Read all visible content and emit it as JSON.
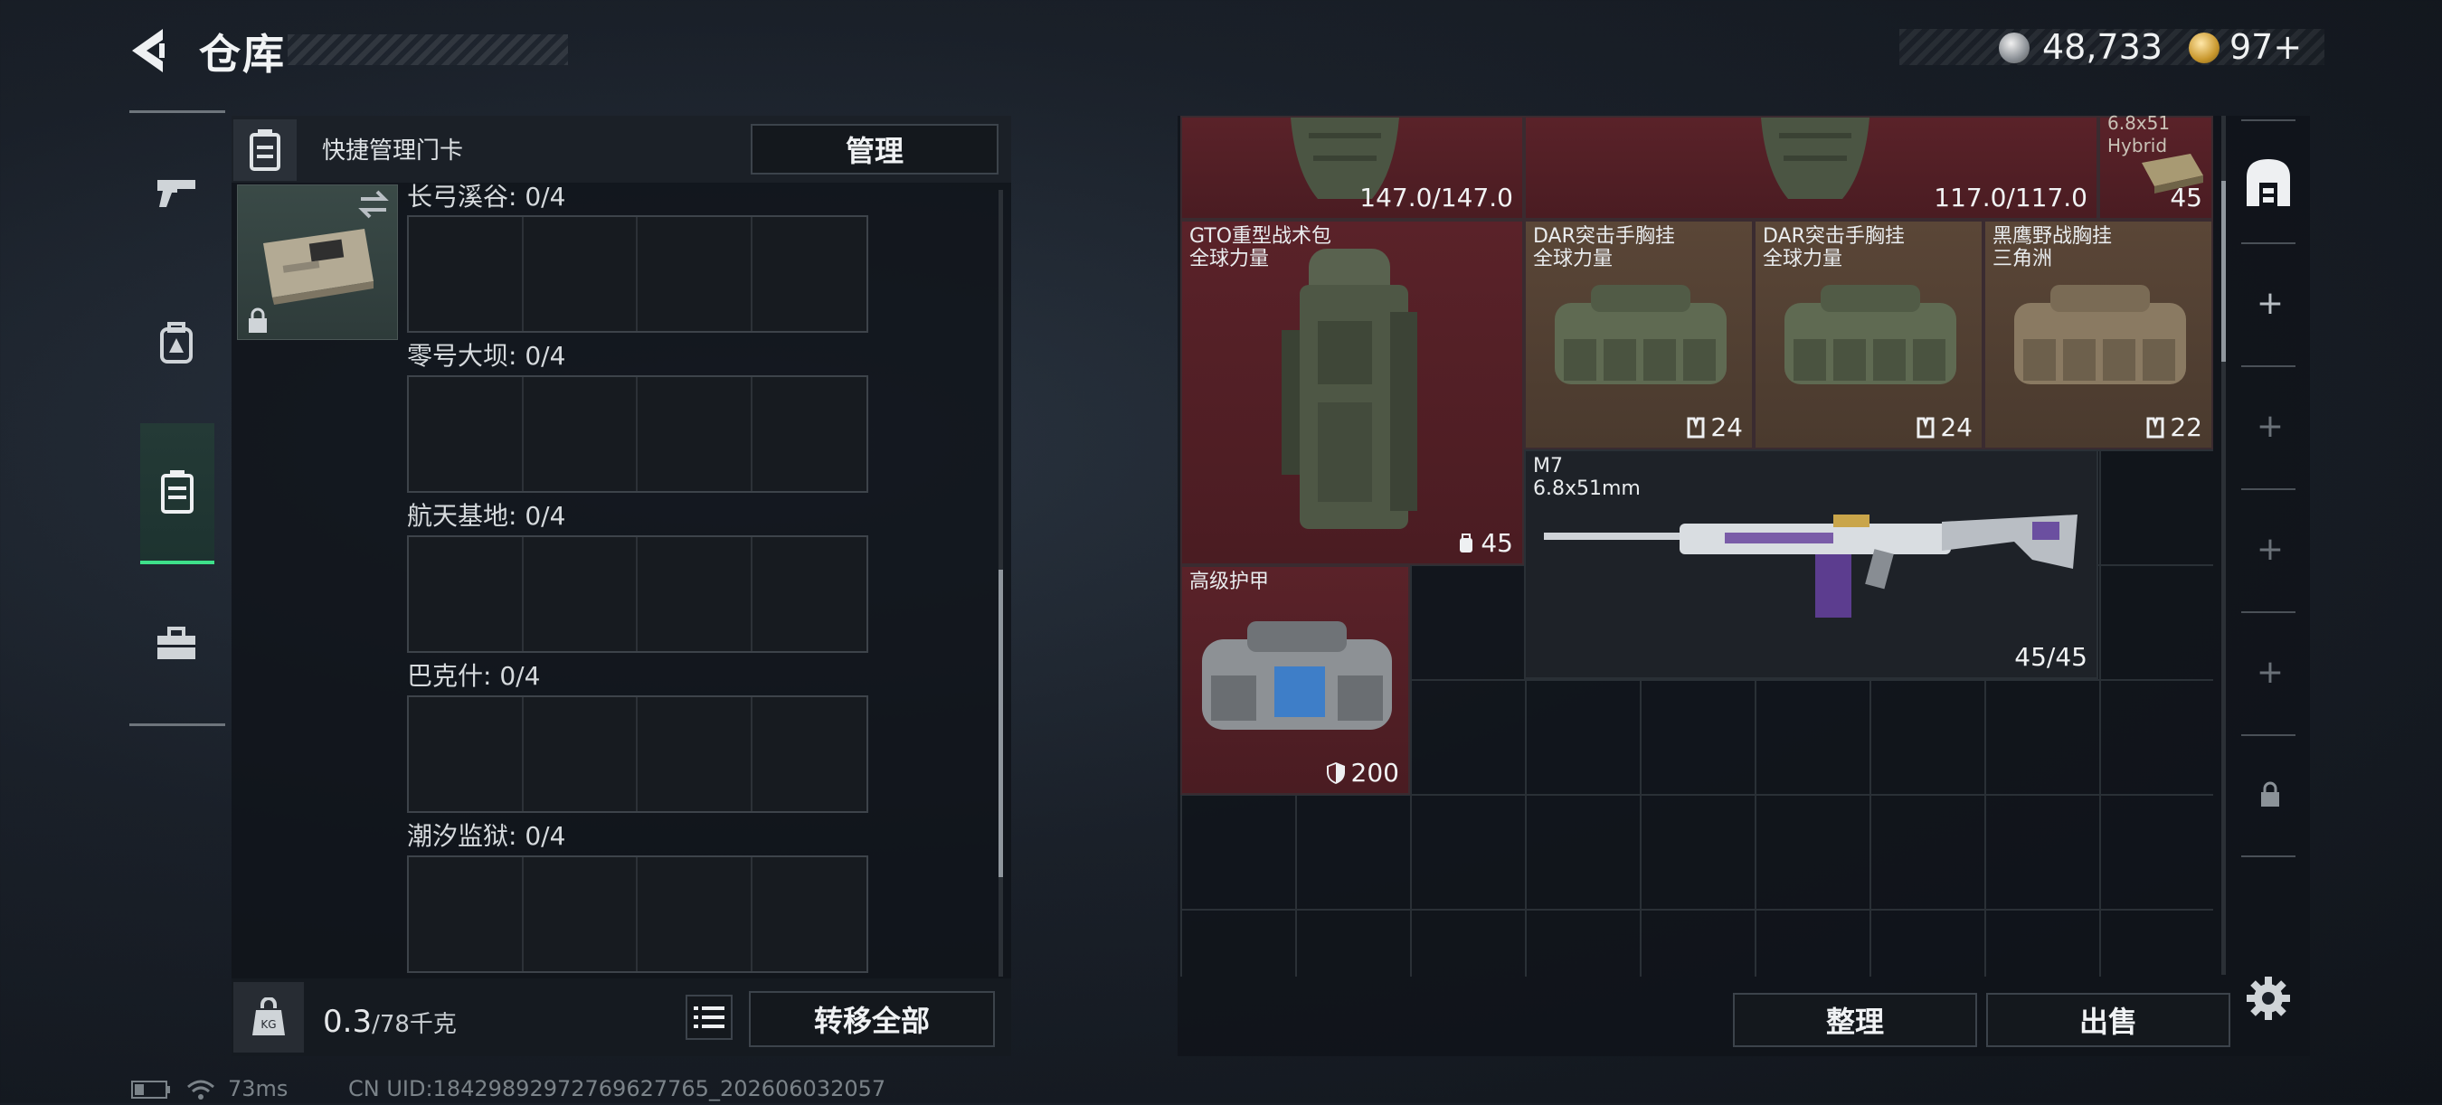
{
  "header": {
    "title": "仓库",
    "currency_silver": "48,733",
    "currency_gold": "97+"
  },
  "left_nav": {
    "items": [
      "weapon",
      "equipment",
      "keycard",
      "toolbox"
    ],
    "active": "keycard"
  },
  "keycard_panel": {
    "title": "快捷管理门卡",
    "manage_label": "管理",
    "rooms": [
      {
        "label": "长弓溪谷: 0/4"
      },
      {
        "label": "零号大坝: 0/4"
      },
      {
        "label": "航天基地: 0/4"
      },
      {
        "label": "巴克什: 0/4"
      },
      {
        "label": "潮汐监狱: 0/4"
      }
    ],
    "weight_value": "0.3",
    "weight_max": "/78千克",
    "transfer_all_label": "转移全部"
  },
  "warehouse": {
    "items": [
      {
        "name": "",
        "value": "147.0/147.0"
      },
      {
        "name": "",
        "value": "117.0/117.0"
      },
      {
        "name": "6.8x51\nHybrid",
        "value": "45"
      },
      {
        "name": "GTO重型战术包\n全球力量",
        "value": "45"
      },
      {
        "name": "DAR突击手胸挂\n全球力量",
        "value": "24"
      },
      {
        "name": "DAR突击手胸挂\n全球力量",
        "value": "24"
      },
      {
        "name": "黑鹰野战胸挂\n三角洲",
        "value": "22"
      },
      {
        "name": "M7\n6.8x51mm",
        "value": "45/45"
      },
      {
        "name": "高级护甲",
        "value": "200"
      }
    ],
    "sort_label": "整理",
    "sell_label": "出售"
  },
  "status_bar": {
    "ping": "73ms",
    "uid": "CN UID:18429892972769627765_202606032057"
  },
  "colors": {
    "accent_green": "#3ee08a",
    "item_red": "#5a2229",
    "item_brown": "#5a4637"
  }
}
